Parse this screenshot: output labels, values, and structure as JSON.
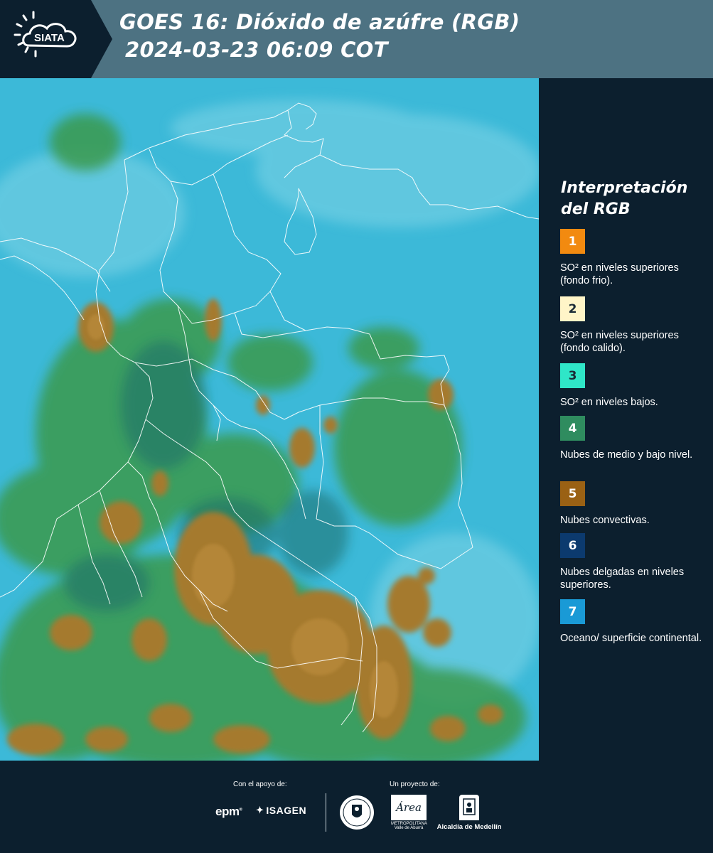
{
  "header": {
    "logo_text": "SIATA",
    "title_line1": "GOES 16: Dióxido de azúfre (RGB)",
    "title_line2": "2024-03-23 06:09 COT"
  },
  "legend": {
    "title": "Interpretación del RGB",
    "items": [
      {
        "number": "1",
        "label": "SO² en niveles superiores (fondo frio).",
        "color": "#f28a10"
      },
      {
        "number": "2",
        "label": "SO² en niveles superiores (fondo calido).",
        "color": "#fff5c8"
      },
      {
        "number": "3",
        "label": "SO² en niveles bajos.",
        "color": "#2fe6c8"
      },
      {
        "number": "4",
        "label": "Nubes de medio y bajo nivel.",
        "color": "#2f8c5f"
      },
      {
        "number": "5",
        "label": "Nubes convectivas.",
        "color": "#9a6114"
      },
      {
        "number": "6",
        "label": "Nubes delgadas en niveles superiores.",
        "color": "#0c3a6e"
      },
      {
        "number": "7",
        "label": "Oceano/ superficie continental.",
        "color": "#1a9ad6"
      }
    ]
  },
  "footer": {
    "support_label": "Con el apoyo de:",
    "project_label": "Un proyecto de:",
    "epm": "epm",
    "isagen": "ISAGEN",
    "area_logo": "Área",
    "area_sub": "METROPOLITANA Valle de Aburrá",
    "alcaldia": "Alcaldía de Medellín"
  },
  "colors": {
    "header_bg": "#4d7282",
    "page_bg": "#0c1f2e",
    "map_cyan": "#38b8d8",
    "map_green": "#3f9b4e",
    "map_convective": "#a4782e",
    "border_lines": "#ffffff"
  }
}
